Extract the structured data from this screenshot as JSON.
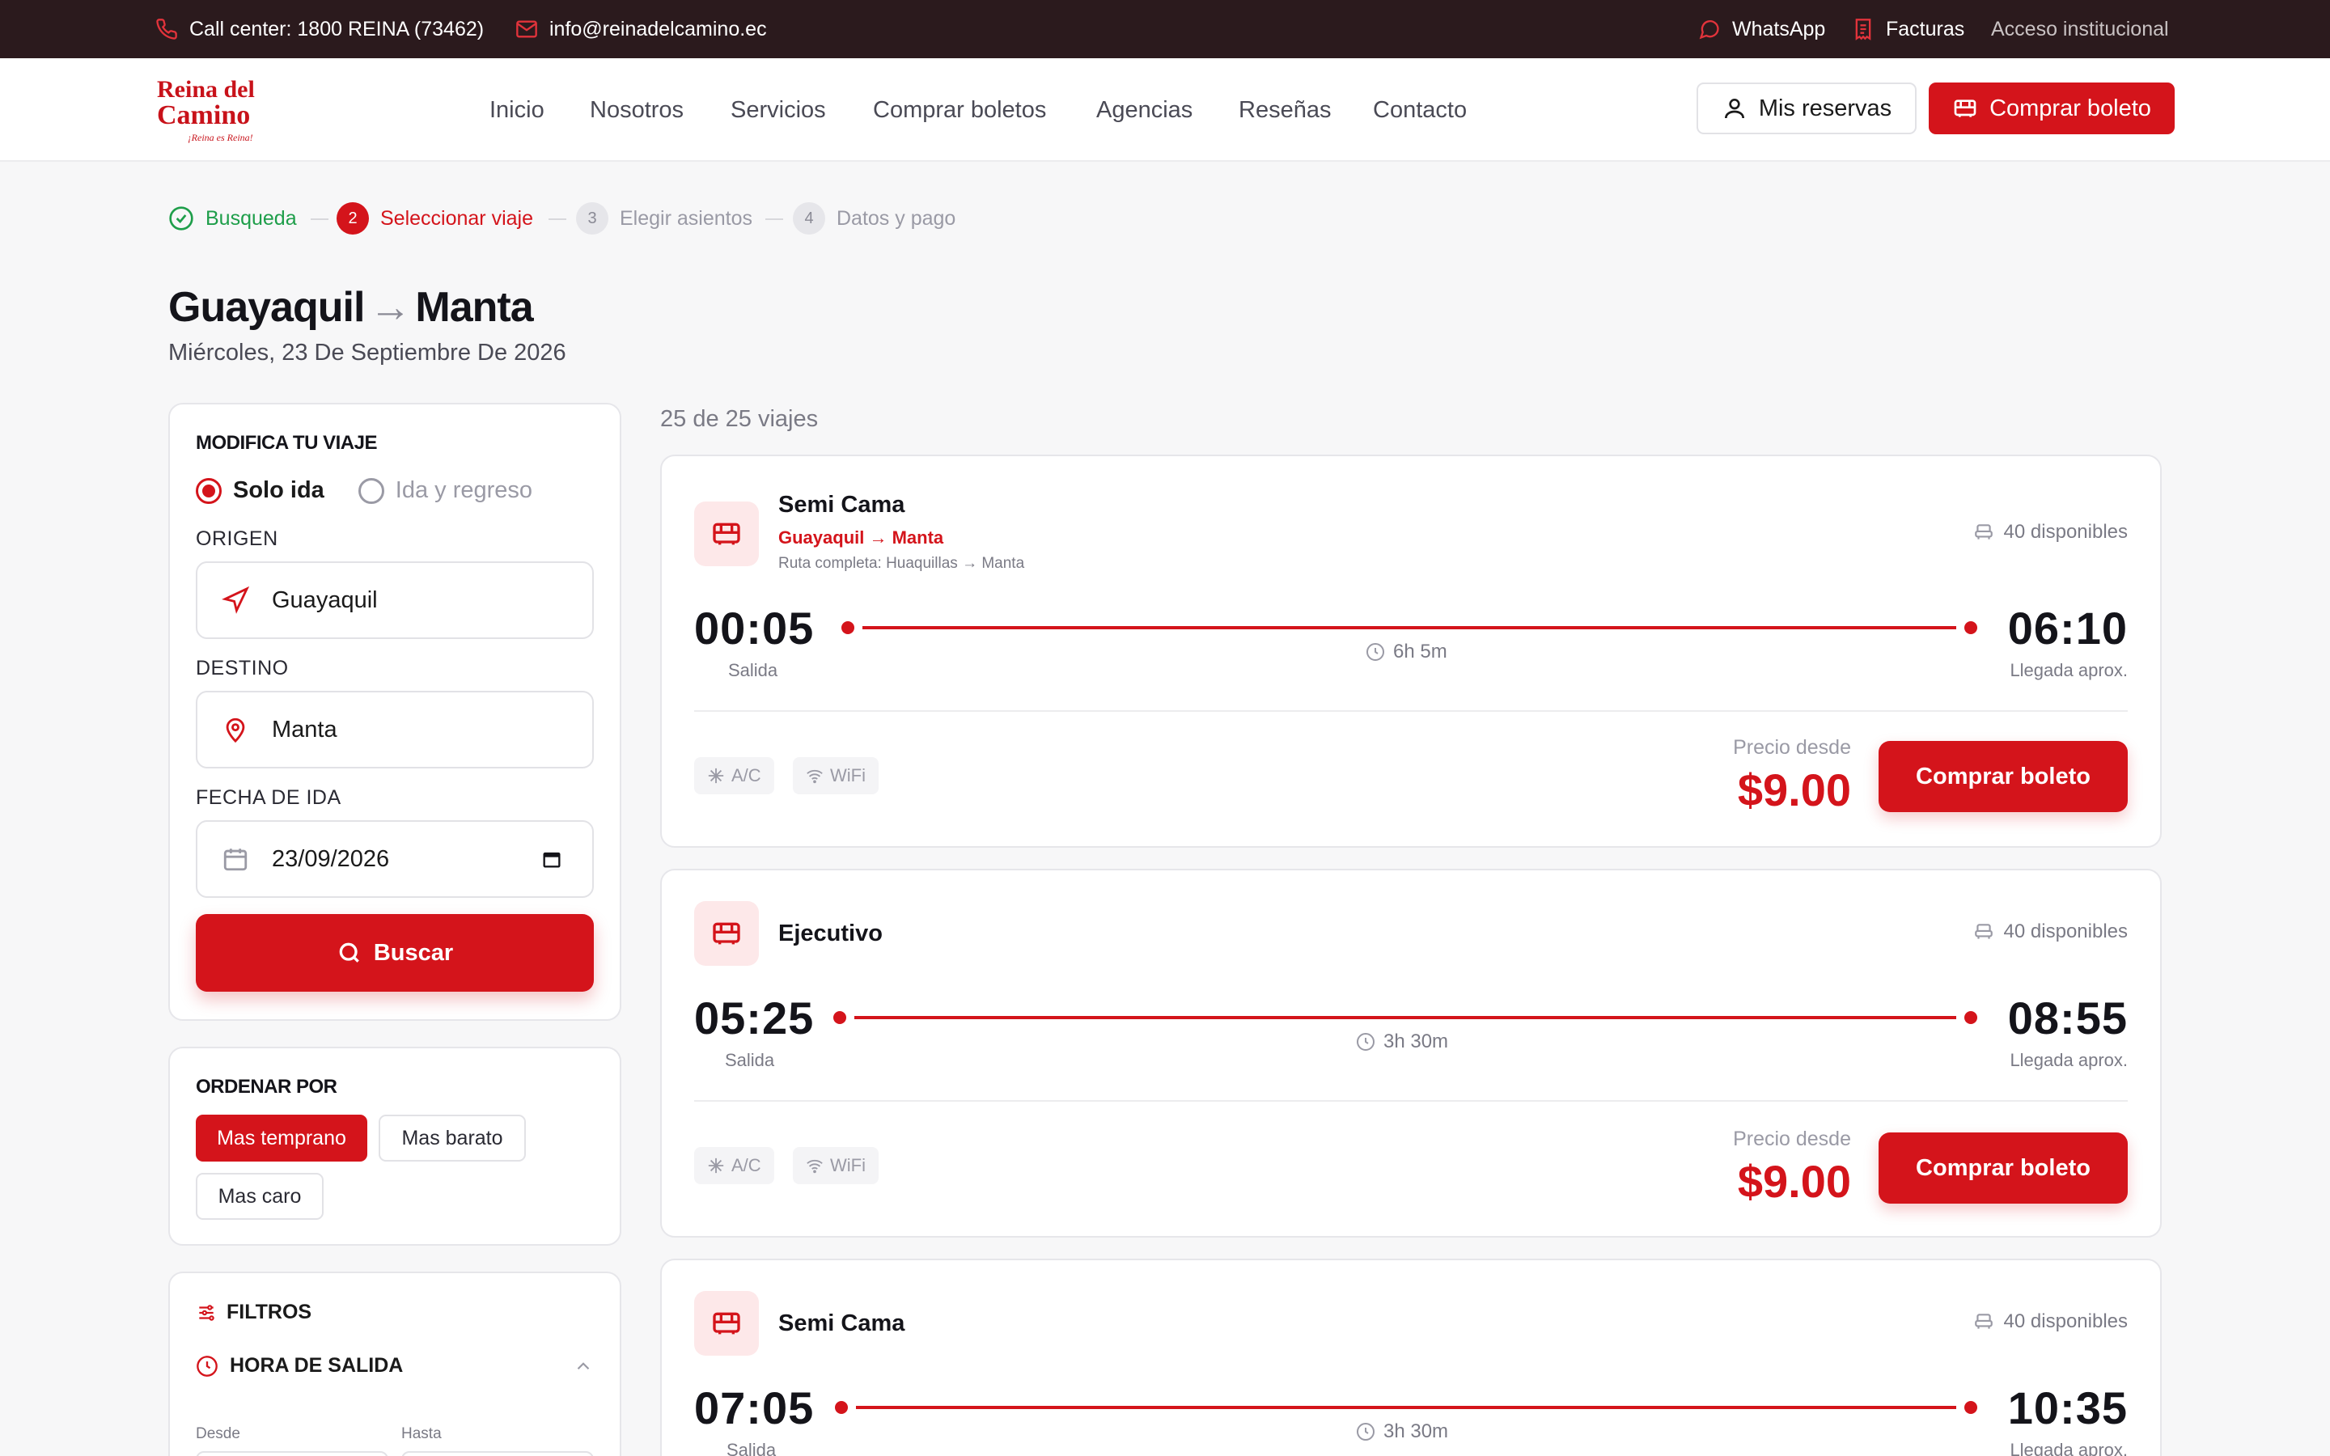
{
  "topbar": {
    "phone": "Call center: 1800 REINA (73462)",
    "email": "info@reinadelcamino.ec",
    "whatsapp": "WhatsApp",
    "invoices": "Facturas",
    "institutional": "Acceso institucional"
  },
  "logo": {
    "line1": "Reina del",
    "line2": "Camino",
    "tagline": "¡Reina es Reina!"
  },
  "nav": [
    "Inicio",
    "Nosotros",
    "Servicios",
    "Comprar boletos",
    "Agencias",
    "Reseñas",
    "Contacto"
  ],
  "header_buttons": {
    "reservations": "Mis reservas",
    "buy": "Comprar boleto"
  },
  "stepper": [
    {
      "number": "1",
      "label": "Busqueda",
      "state": "done"
    },
    {
      "number": "2",
      "label": "Seleccionar viaje",
      "state": "active"
    },
    {
      "number": "3",
      "label": "Elegir asientos",
      "state": "pending"
    },
    {
      "number": "4",
      "label": "Datos y pago",
      "state": "pending"
    }
  ],
  "route": {
    "origin": "Guayaquil",
    "arrow": "→",
    "destination": "Manta",
    "date": "Miércoles, 23 De Septiembre De 2026"
  },
  "modify": {
    "title": "MODIFICA TU VIAJE",
    "one_way": "Solo ida",
    "round_trip": "Ida y regreso",
    "origin_label": "ORIGEN",
    "origin_value": "Guayaquil",
    "destination_label": "DESTINO",
    "destination_value": "Manta",
    "date_label": "FECHA DE IDA",
    "date_value": "23/09/2026",
    "search": "Buscar"
  },
  "sort": {
    "title": "ORDENAR POR",
    "options": [
      "Mas temprano",
      "Mas barato",
      "Mas caro"
    ],
    "selected": "Mas temprano"
  },
  "filters": {
    "title": "FILTROS",
    "section": "HORA DE SALIDA",
    "from": "Desde",
    "to": "Hasta"
  },
  "results_count": "25 de 25 viajes",
  "trips": [
    {
      "type": "Semi Cama",
      "route": "Guayaquil → Manta",
      "full_route": "Ruta completa: Huaquillas → Manta",
      "seats": "40 disponibles",
      "departure": "00:05",
      "departure_label": "Salida",
      "arrival": "06:10",
      "arrival_label": "Llegada aprox.",
      "duration": "6h 5m",
      "amenities": [
        "A/C",
        "WiFi"
      ],
      "price_label": "Precio desde",
      "price": "$9.00",
      "buy": "Comprar boleto"
    },
    {
      "type": "Ejecutivo",
      "seats": "40 disponibles",
      "departure": "05:25",
      "departure_label": "Salida",
      "arrival": "08:55",
      "arrival_label": "Llegada aprox.",
      "duration": "3h 30m",
      "amenities": [
        "A/C",
        "WiFi"
      ],
      "price_label": "Precio desde",
      "price": "$9.00",
      "buy": "Comprar boleto"
    },
    {
      "type": "Semi Cama",
      "seats": "40 disponibles",
      "departure": "07:05",
      "departure_label": "Salida",
      "arrival": "10:35",
      "arrival_label": "Llegada aprox.",
      "duration": "3h 30m"
    }
  ],
  "colors": {
    "brand": "#d4141b",
    "topbar": "#2b1a1d",
    "success": "#1e9e4a"
  }
}
